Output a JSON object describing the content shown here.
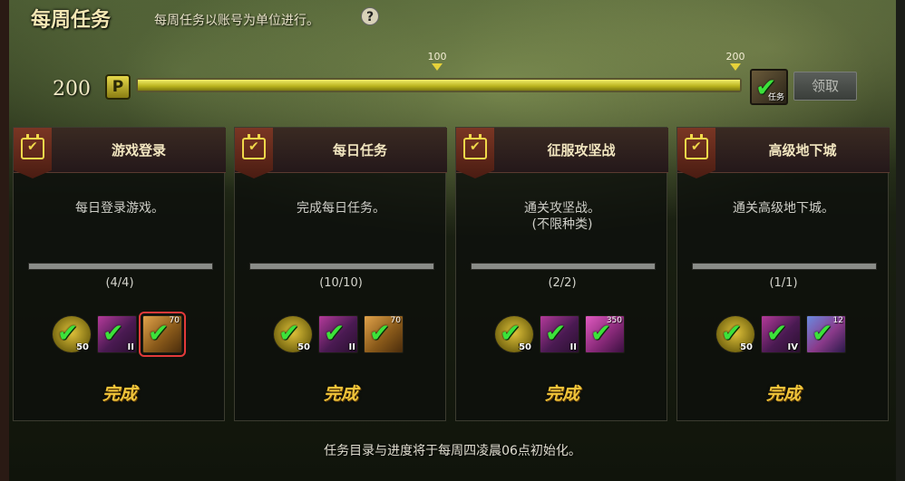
{
  "header": {
    "title": "每周任务",
    "subtitle": "每周任务以账号为单位进行。",
    "help_icon": "?"
  },
  "progress": {
    "points": "200",
    "points_badge": "P",
    "value": 200,
    "max": 200,
    "fill_percent": 100,
    "milestones": [
      "100",
      "200"
    ],
    "reward_tag": "任务",
    "claim_label": "领取"
  },
  "cards": [
    {
      "title": "游戏登录",
      "desc": "每日登录游戏。",
      "desc2": "",
      "count": "(4/4)",
      "done": "完成",
      "rewards": [
        {
          "icon": "gold-coin-icon",
          "label": "50",
          "top": ""
        },
        {
          "icon": "purple-box-icon",
          "label": "II",
          "top": ""
        },
        {
          "icon": "orange-box-icon",
          "label": "",
          "top": "70"
        }
      ]
    },
    {
      "title": "每日任务",
      "desc": "完成每日任务。",
      "desc2": "",
      "count": "(10/10)",
      "done": "完成",
      "rewards": [
        {
          "icon": "gold-coin-icon",
          "label": "50",
          "top": ""
        },
        {
          "icon": "purple-box-icon",
          "label": "II",
          "top": ""
        },
        {
          "icon": "orange-box-icon",
          "label": "",
          "top": "70"
        }
      ]
    },
    {
      "title": "征服攻坚战",
      "desc": "通关攻坚战。",
      "desc2": "(不限种类)",
      "count": "(2/2)",
      "done": "完成",
      "rewards": [
        {
          "icon": "gold-coin-icon",
          "label": "50",
          "top": ""
        },
        {
          "icon": "purple-box-icon",
          "label": "II",
          "top": ""
        },
        {
          "icon": "pink-box-icon",
          "label": "",
          "top": "350"
        }
      ]
    },
    {
      "title": "高级地下城",
      "desc": "通关高级地下城。",
      "desc2": "",
      "count": "(1/1)",
      "done": "完成",
      "rewards": [
        {
          "icon": "gold-coin-icon",
          "label": "50",
          "top": ""
        },
        {
          "icon": "purple-box-icon",
          "label": "IV",
          "top": ""
        },
        {
          "icon": "blue-box-icon",
          "label": "",
          "top": "12"
        }
      ]
    }
  ],
  "footer": "任务目录与进度将于每周四凌晨06点初始化。",
  "colors": {
    "accent_gold": "#f0c43a",
    "check_green": "#3ce23a",
    "bar_yellow": "#f2ee6a",
    "selection_red": "#e23a3a"
  }
}
